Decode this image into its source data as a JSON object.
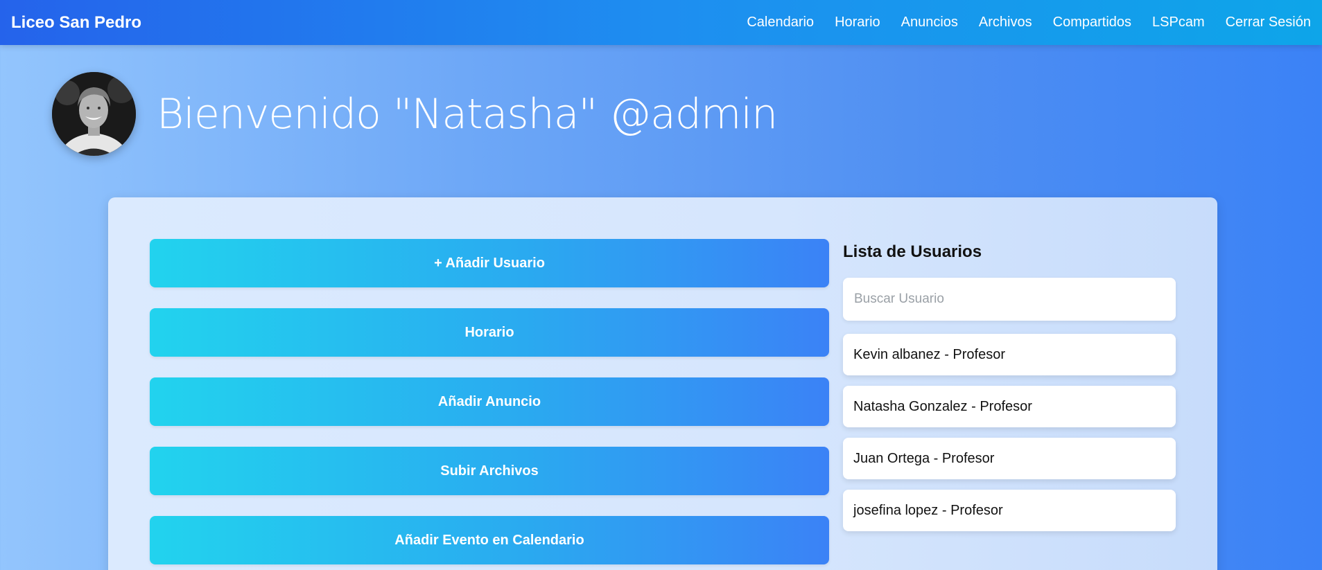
{
  "navbar": {
    "brand": "Liceo San Pedro",
    "links": [
      "Calendario",
      "Horario",
      "Anuncios",
      "Archivos",
      "Compartidos",
      "LSPcam",
      "Cerrar Sesión"
    ]
  },
  "header": {
    "avatar_icon": "user-avatar-icon",
    "welcome": "Bienvenido \"Natasha\" @admin"
  },
  "actions": {
    "add_user": "+ Añadir Usuario",
    "schedule": "Horario",
    "add_announcement": "Añadir Anuncio",
    "upload_files": "Subir Archivos",
    "add_calendar_event": "Añadir Evento en Calendario"
  },
  "users": {
    "title": "Lista de Usuarios",
    "search_placeholder": "Buscar Usuario",
    "items": [
      "Kevin albanez - Profesor",
      "Natasha Gonzalez - Profesor",
      "Juan Ortega - Profesor",
      "josefina lopez - Profesor"
    ]
  },
  "colors": {
    "navbar_start": "#2563eb",
    "navbar_end": "#0ea5e9",
    "button_start": "#22d3ee",
    "button_end": "#3b82f6"
  }
}
